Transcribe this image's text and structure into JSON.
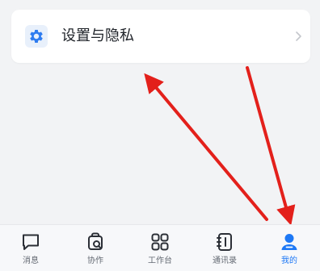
{
  "settings": {
    "label": "设置与隐私",
    "icon": "gear-icon",
    "chevron": "chevron-right-icon"
  },
  "tabbar": {
    "items": [
      {
        "label": "消息",
        "icon": "message-icon",
        "active": false
      },
      {
        "label": "协作",
        "icon": "collaboration-icon",
        "active": false
      },
      {
        "label": "工作台",
        "icon": "workbench-icon",
        "active": false
      },
      {
        "label": "通讯录",
        "icon": "contacts-icon",
        "active": false
      },
      {
        "label": "我的",
        "icon": "profile-icon",
        "active": true
      }
    ]
  },
  "colors": {
    "accent": "#1d78f5",
    "annotation_arrow": "#e3201b",
    "background": "#f2f3f5",
    "icon_gray": "#2b2f36"
  }
}
